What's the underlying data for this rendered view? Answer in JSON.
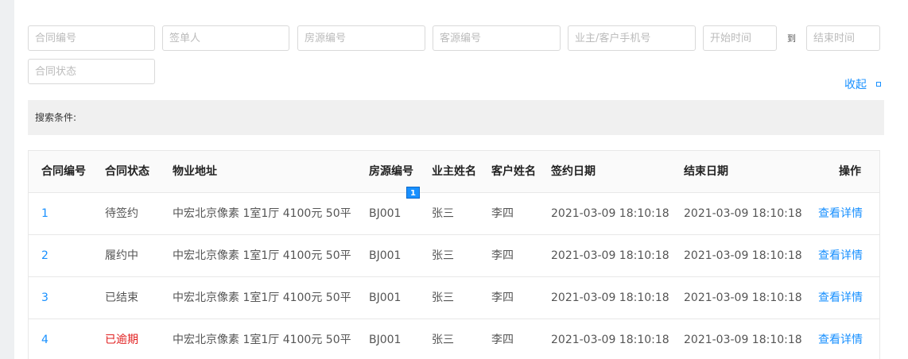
{
  "filters": {
    "contract_no": "合同编号",
    "signer": "签单人",
    "house_no": "房源编号",
    "client_no": "客源编号",
    "phone": "业主/客户手机号",
    "start_time": "开始时间",
    "to": "到",
    "end_time": "结束时间",
    "status": "合同状态",
    "collapse_label": "收起"
  },
  "search_conditions_label": "搜索条件:",
  "table": {
    "columns": [
      "合同编号",
      "合同状态",
      "物业地址",
      "房源编号",
      "业主姓名",
      "客户姓名",
      "签约日期",
      "结束日期",
      "操作"
    ],
    "badge": "1",
    "rows": [
      {
        "id": "1",
        "status": "待签约",
        "address": "中宏北京像素 1室1厅 4100元 50平",
        "house": "BJ001",
        "owner": "张三",
        "client": "李四",
        "sign_date": "2021-03-09 18:10:18",
        "end_date": "2021-03-09 18:10:18",
        "action": "查看详情"
      },
      {
        "id": "2",
        "status": "履约中",
        "address": "中宏北京像素 1室1厅 4100元 50平",
        "house": "BJ001",
        "owner": "张三",
        "client": "李四",
        "sign_date": "2021-03-09 18:10:18",
        "end_date": "2021-03-09 18:10:18",
        "action": "查看详情"
      },
      {
        "id": "3",
        "status": "已结束",
        "address": "中宏北京像素 1室1厅 4100元 50平",
        "house": "BJ001",
        "owner": "张三",
        "client": "李四",
        "sign_date": "2021-03-09 18:10:18",
        "end_date": "2021-03-09 18:10:18",
        "action": "查看详情"
      },
      {
        "id": "4",
        "status": "已逾期",
        "address": "中宏北京像素 1室1厅 4100元 50平",
        "house": "BJ001",
        "owner": "张三",
        "client": "李四",
        "sign_date": "2021-03-09 18:10:18",
        "end_date": "2021-03-09 18:10:18",
        "action": "查看详情"
      }
    ]
  },
  "colors": {
    "link": "#1890ff",
    "overdue": "#e11e1e"
  }
}
